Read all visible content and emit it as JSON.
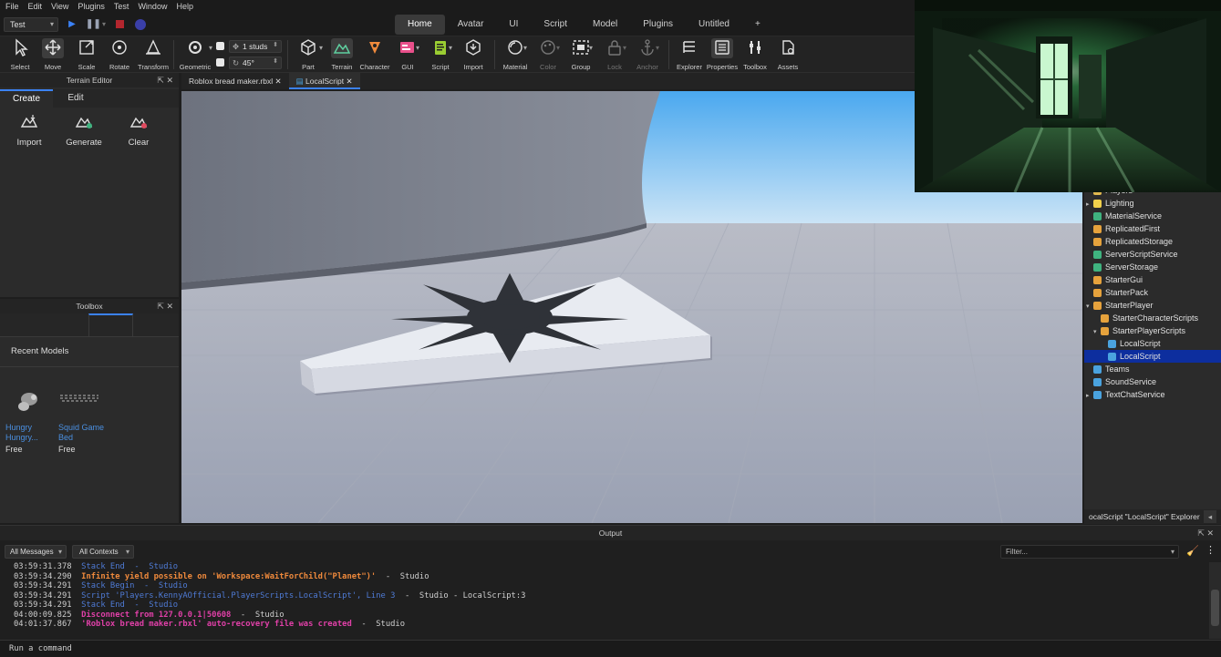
{
  "menu": [
    "File",
    "Edit",
    "View",
    "Plugins",
    "Test",
    "Window",
    "Help"
  ],
  "mode_select": "Test",
  "tabs": [
    {
      "label": "Home",
      "active": true
    },
    {
      "label": "Avatar",
      "active": false
    },
    {
      "label": "UI",
      "active": false
    },
    {
      "label": "Script",
      "active": false
    },
    {
      "label": "Model",
      "active": false
    },
    {
      "label": "Plugins",
      "active": false
    },
    {
      "label": "Untitled",
      "active": false
    }
  ],
  "add_tab": "+",
  "toolbar": {
    "select": "Select",
    "move": "Move",
    "scale": "Scale",
    "rotate": "Rotate",
    "transform": "Transform",
    "geometric": "Geometric",
    "studs": "1 studs",
    "angle": "45°",
    "part": "Part",
    "terrain": "Terrain",
    "character": "Character",
    "gui": "GUI",
    "script": "Script",
    "import": "Import",
    "material": "Material",
    "color": "Color",
    "group": "Group",
    "lock": "Lock",
    "anchor": "Anchor",
    "explorer": "Explorer",
    "properties": "Properties",
    "toolbox": "Toolbox",
    "assets": "Assets"
  },
  "terrain_editor": {
    "title": "Terrain Editor",
    "tabs": [
      "Create",
      "Edit"
    ],
    "actions": [
      "Import",
      "Generate",
      "Clear"
    ]
  },
  "toolbox": {
    "title": "Toolbox",
    "section": "Recent Models",
    "items": [
      {
        "name": "Hungry Hungry...",
        "price": "Free"
      },
      {
        "name": "Squid Game Bed",
        "price": "Free"
      }
    ]
  },
  "doc_tabs": [
    {
      "label": "Roblox bread maker.rbxl",
      "active": false
    },
    {
      "label": "LocalScript",
      "active": true
    }
  ],
  "explorer": {
    "items": [
      {
        "label": "Players",
        "indent": 0,
        "arrow": false,
        "color": "#e0b84f",
        "selected": false
      },
      {
        "label": "Lighting",
        "indent": 0,
        "arrow": true,
        "color": "#f2d14b",
        "selected": false
      },
      {
        "label": "MaterialService",
        "indent": 0,
        "arrow": false,
        "color": "#3fb37f",
        "selected": false
      },
      {
        "label": "ReplicatedFirst",
        "indent": 0,
        "arrow": false,
        "color": "#e6a23c",
        "selected": false
      },
      {
        "label": "ReplicatedStorage",
        "indent": 0,
        "arrow": false,
        "color": "#e6a23c",
        "selected": false
      },
      {
        "label": "ServerScriptService",
        "indent": 0,
        "arrow": false,
        "color": "#3fb37f",
        "selected": false
      },
      {
        "label": "ServerStorage",
        "indent": 0,
        "arrow": false,
        "color": "#3fb37f",
        "selected": false
      },
      {
        "label": "StarterGui",
        "indent": 0,
        "arrow": false,
        "color": "#e6a23c",
        "selected": false
      },
      {
        "label": "StarterPack",
        "indent": 0,
        "arrow": false,
        "color": "#e6a23c",
        "selected": false
      },
      {
        "label": "StarterPlayer",
        "indent": 0,
        "arrow": "open",
        "color": "#e6a23c",
        "selected": false
      },
      {
        "label": "StarterCharacterScripts",
        "indent": 1,
        "arrow": false,
        "color": "#e6a23c",
        "selected": false
      },
      {
        "label": "StarterPlayerScripts",
        "indent": 1,
        "arrow": "open",
        "color": "#e6a23c",
        "selected": false
      },
      {
        "label": "LocalScript",
        "indent": 2,
        "arrow": false,
        "color": "#4aa3df",
        "selected": false
      },
      {
        "label": "LocalScript",
        "indent": 2,
        "arrow": false,
        "color": "#4aa3df",
        "selected": true
      },
      {
        "label": "Teams",
        "indent": 0,
        "arrow": false,
        "color": "#4aa3df",
        "selected": false
      },
      {
        "label": "SoundService",
        "indent": 0,
        "arrow": false,
        "color": "#4aa3df",
        "selected": false
      },
      {
        "label": "TextChatService",
        "indent": 0,
        "arrow": true,
        "color": "#4aa3df",
        "selected": false
      }
    ],
    "footer_left": "ocalScript \"LocalScript\"",
    "footer_tab": "Explorer"
  },
  "output": {
    "title": "Output",
    "filter_messages": "All Messages",
    "filter_contexts": "All Contexts",
    "filter_placeholder": "Filter...",
    "lines": [
      {
        "time": "03:59:31.378",
        "text": "Stack End  -  Studio",
        "color": "#4f7bd6",
        "tail": "",
        "tail_color": "#cfcfcf"
      },
      {
        "time": "03:59:34.290",
        "text": "Infinite yield possible on 'Workspace:WaitForChild(\"Planet\")'",
        "color": "#f08a3c",
        "tail": "  -  Studio",
        "tail_color": "#cfcfcf"
      },
      {
        "time": "03:59:34.291",
        "text": "Stack Begin  -  Studio",
        "color": "#4f7bd6",
        "tail": "",
        "tail_color": "#cfcfcf"
      },
      {
        "time": "03:59:34.291",
        "text": "Script 'Players.KennyAOfficial.PlayerScripts.LocalScript', Line 3",
        "color": "#4f7bd6",
        "tail": "  -  Studio - LocalScript:3",
        "tail_color": "#cfcfcf"
      },
      {
        "time": "03:59:34.291",
        "text": "Stack End  -  Studio",
        "color": "#4f7bd6",
        "tail": "",
        "tail_color": "#cfcfcf"
      },
      {
        "time": "04:00:09.825",
        "text": "Disconnect from 127.0.0.1|50608",
        "color": "#e040a8",
        "tail": "  -  Studio",
        "tail_color": "#cfcfcf"
      },
      {
        "time": "04:01:37.867",
        "text": "'Roblox bread maker.rbxl' auto-recovery file was created",
        "color": "#e040a8",
        "tail": "  -  Studio",
        "tail_color": "#cfcfcf"
      }
    ],
    "command_placeholder": "Run a command"
  }
}
